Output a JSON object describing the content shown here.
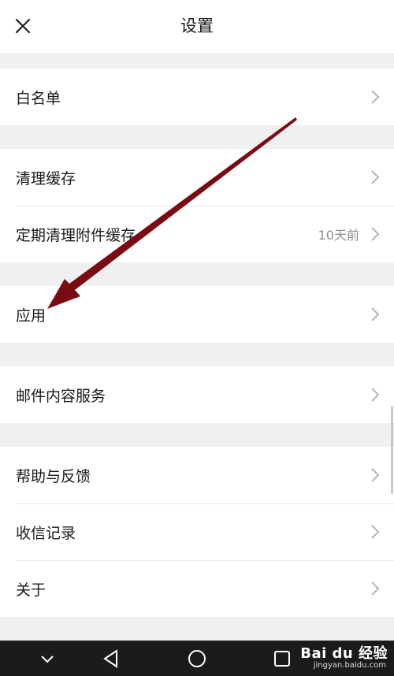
{
  "header": {
    "title": "设置"
  },
  "groups": [
    {
      "items": [
        {
          "label": "白名单"
        }
      ]
    },
    {
      "items": [
        {
          "label": "清理缓存"
        },
        {
          "label": "定期清理附件缓存",
          "value": "10天前"
        }
      ]
    },
    {
      "items": [
        {
          "label": "应用"
        }
      ]
    },
    {
      "items": [
        {
          "label": "邮件内容服务"
        }
      ]
    },
    {
      "items": [
        {
          "label": "帮助与反馈"
        },
        {
          "label": "收信记录"
        },
        {
          "label": "关于"
        }
      ]
    }
  ],
  "annotation": {
    "arrow_color": "#7b0b12"
  },
  "watermark": {
    "logo": "Bai du 经验",
    "url": "jingyan.baidu.com"
  },
  "colors": {
    "background": "#f0f0f2",
    "row_bg": "#ffffff",
    "text": "#1a1a1a",
    "secondary_text": "#8c8c8c",
    "navbar": "#1b1b1b"
  }
}
